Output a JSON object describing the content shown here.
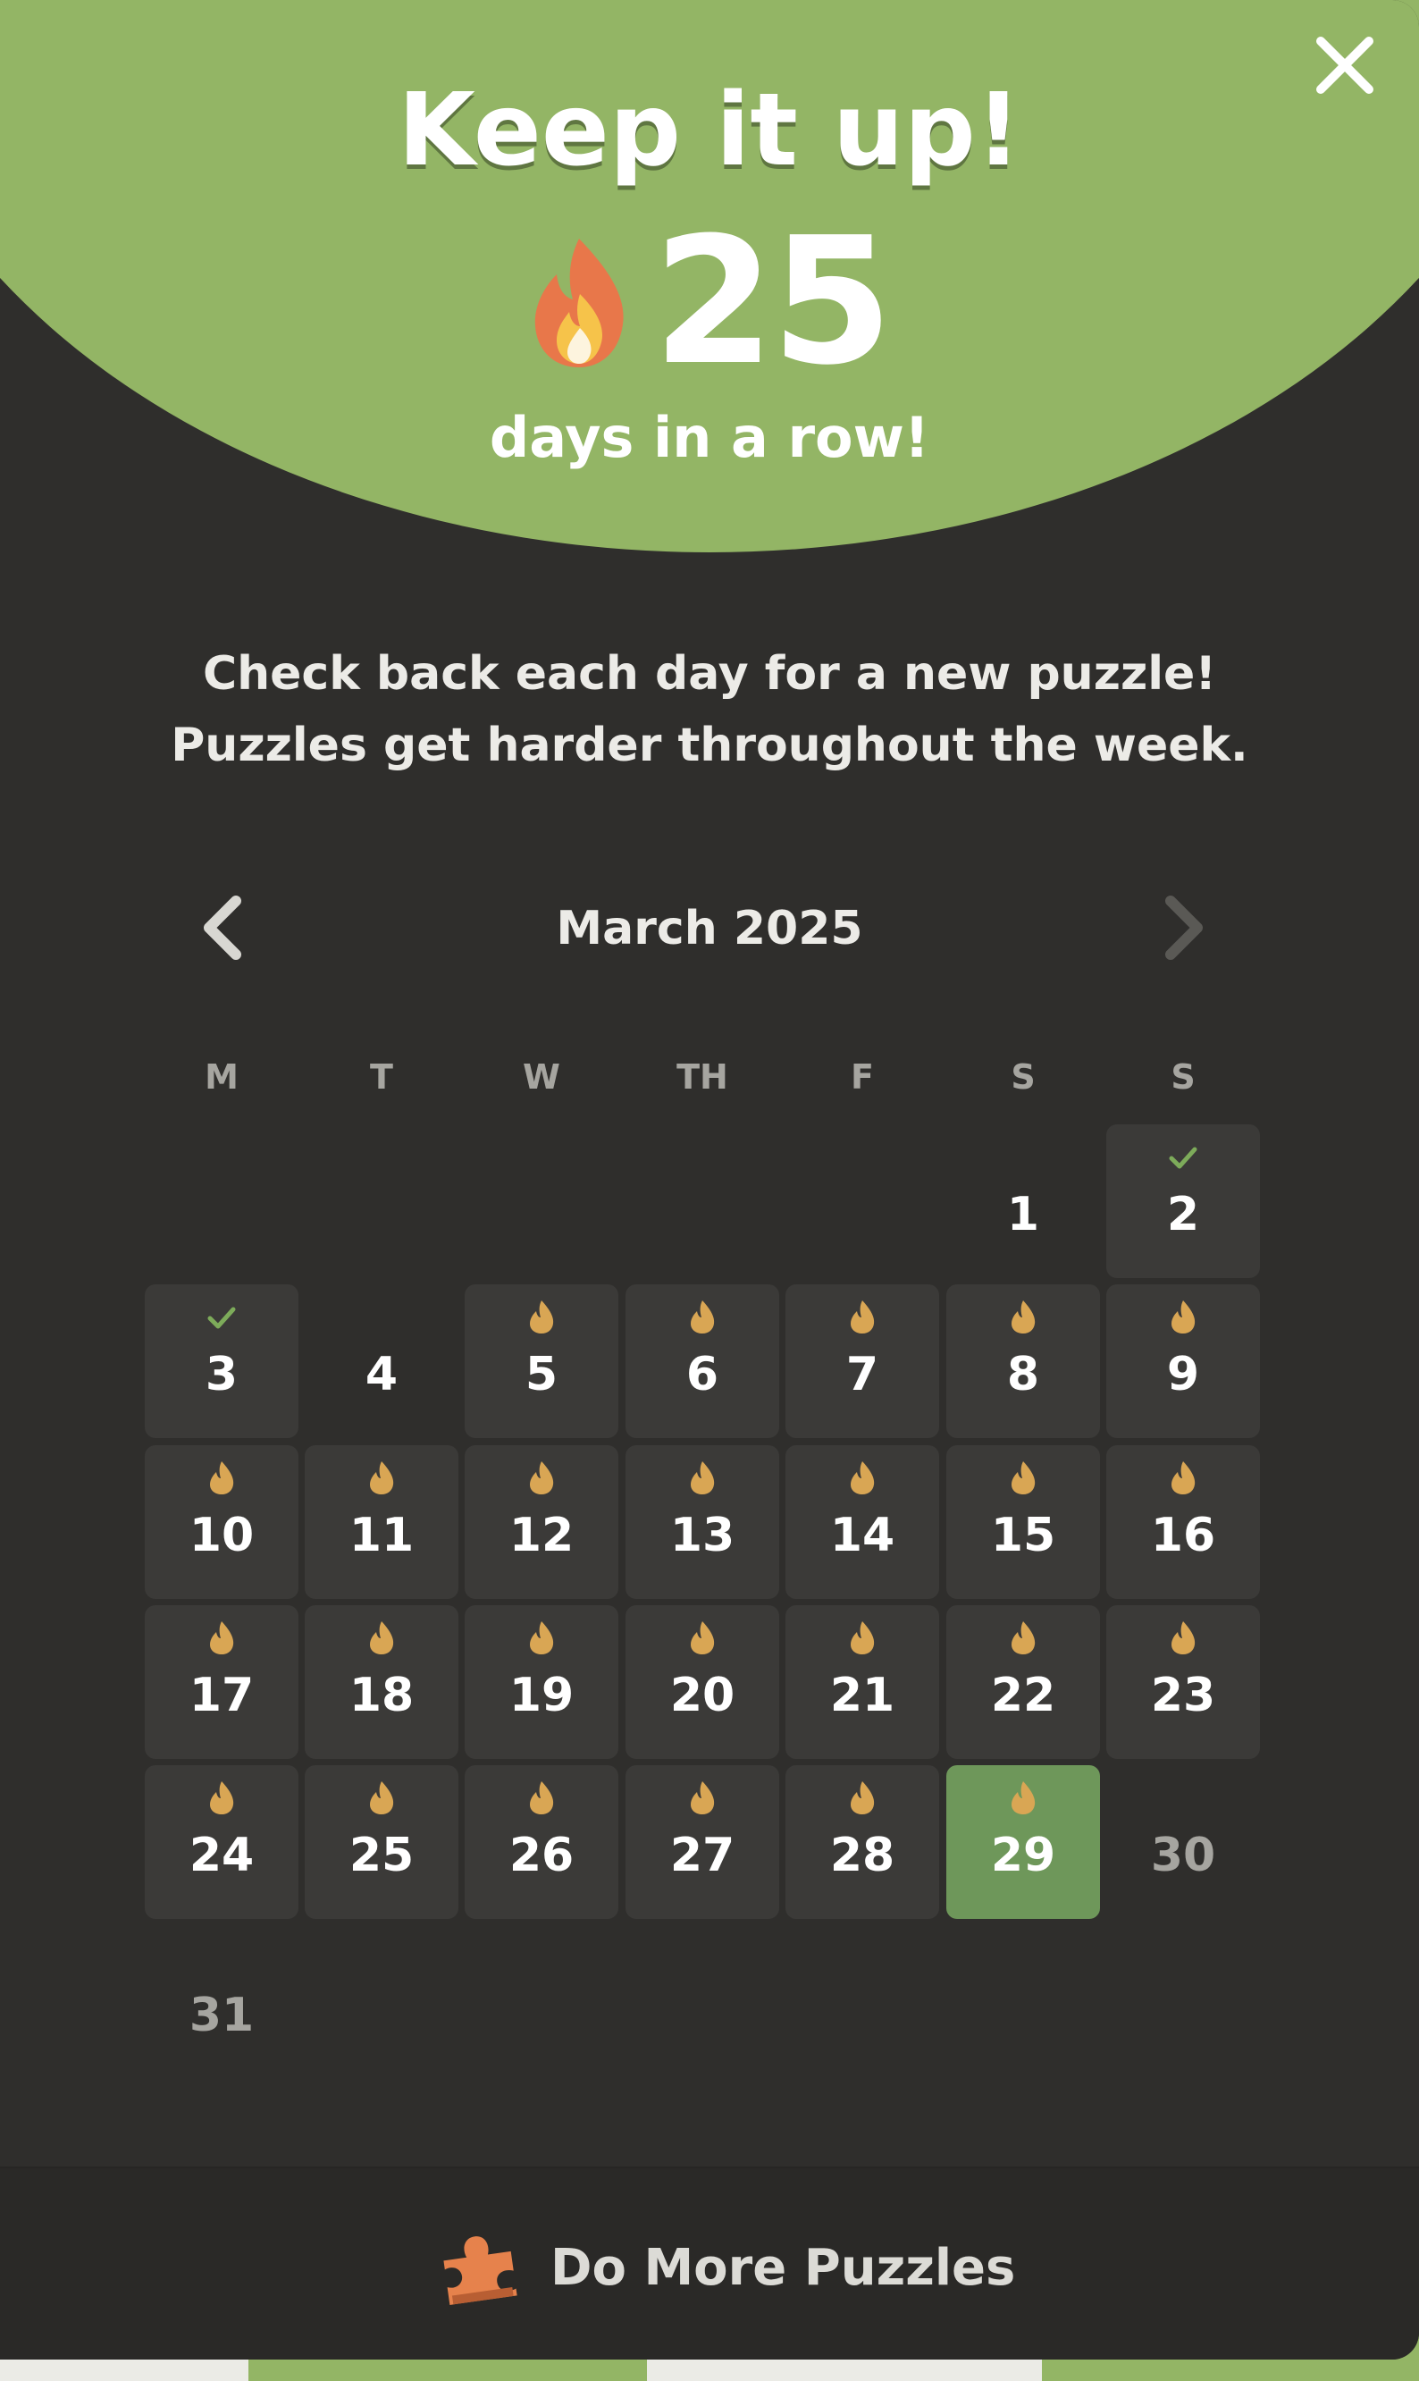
{
  "header": {
    "title": "Keep it up!",
    "streak_count": "25",
    "streak_label": "days in a row!"
  },
  "message": {
    "line1": "Check back each day for a new puzzle!",
    "line2": "Puzzles get harder throughout the week."
  },
  "calendar": {
    "month_label": "March 2025",
    "weekdays": [
      "M",
      "T",
      "W",
      "TH",
      "F",
      "S",
      "S"
    ],
    "days": [
      {
        "day": "1",
        "status": "plain"
      },
      {
        "day": "2",
        "status": "completed"
      },
      {
        "day": "3",
        "status": "completed"
      },
      {
        "day": "4",
        "status": "plain"
      },
      {
        "day": "5",
        "status": "streak"
      },
      {
        "day": "6",
        "status": "streak"
      },
      {
        "day": "7",
        "status": "streak"
      },
      {
        "day": "8",
        "status": "streak"
      },
      {
        "day": "9",
        "status": "streak"
      },
      {
        "day": "10",
        "status": "streak"
      },
      {
        "day": "11",
        "status": "streak"
      },
      {
        "day": "12",
        "status": "streak"
      },
      {
        "day": "13",
        "status": "streak"
      },
      {
        "day": "14",
        "status": "streak"
      },
      {
        "day": "15",
        "status": "streak"
      },
      {
        "day": "16",
        "status": "streak"
      },
      {
        "day": "17",
        "status": "streak"
      },
      {
        "day": "18",
        "status": "streak"
      },
      {
        "day": "19",
        "status": "streak"
      },
      {
        "day": "20",
        "status": "streak"
      },
      {
        "day": "21",
        "status": "streak"
      },
      {
        "day": "22",
        "status": "streak"
      },
      {
        "day": "23",
        "status": "streak"
      },
      {
        "day": "24",
        "status": "streak"
      },
      {
        "day": "25",
        "status": "streak"
      },
      {
        "day": "26",
        "status": "streak"
      },
      {
        "day": "27",
        "status": "streak"
      },
      {
        "day": "28",
        "status": "streak"
      },
      {
        "day": "29",
        "status": "today"
      },
      {
        "day": "30",
        "status": "future"
      },
      {
        "day": "31",
        "status": "future"
      }
    ]
  },
  "footer": {
    "button_label": "Do More Puzzles"
  },
  "icons": {
    "close": "close-icon",
    "streak": "fire-icon",
    "prev": "chevron-left-icon",
    "next": "chevron-right-icon",
    "completed": "checkmark-icon",
    "played": "flame-icon",
    "puzzle": "puzzle-piece-icon"
  },
  "colors": {
    "header_green": "#93b565",
    "background": "#2f2e2c",
    "cell": "#3b3a38",
    "today": "#6e975a",
    "flame": "#d9a654",
    "check": "#7dab5a",
    "fire_outer": "#e8774a",
    "puzzle": "#e6824c"
  }
}
